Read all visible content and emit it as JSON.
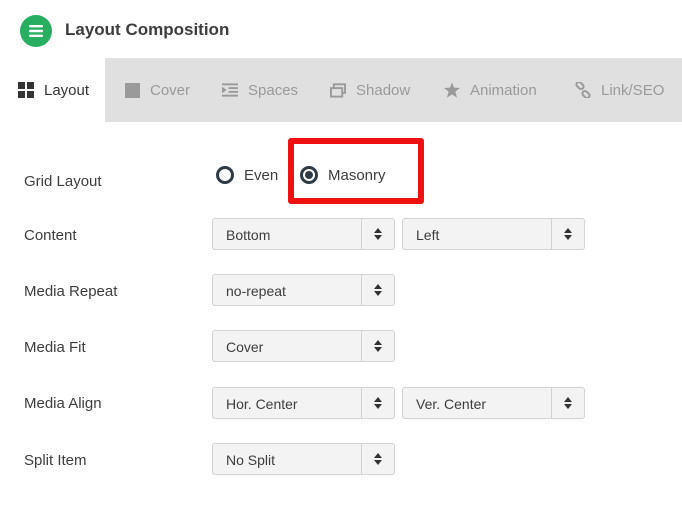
{
  "header": {
    "title": "Layout Composition",
    "icon": "list-icon",
    "accent": "#27ae60"
  },
  "tabs": [
    {
      "label": "Layout",
      "icon": "grid-icon",
      "active": true
    },
    {
      "label": "Cover",
      "icon": "square-icon",
      "active": false
    },
    {
      "label": "Spaces",
      "icon": "indent-icon",
      "active": false
    },
    {
      "label": "Shadow",
      "icon": "shadow-icon",
      "active": false
    },
    {
      "label": "Animation",
      "icon": "star-icon",
      "active": false
    },
    {
      "label": "Link/SEO",
      "icon": "link-icon",
      "active": false
    }
  ],
  "grid_layout": {
    "label": "Grid Layout",
    "options": [
      {
        "label": "Even",
        "checked": false
      },
      {
        "label": "Masonry",
        "checked": true
      }
    ],
    "highlight_color": "#ee1111"
  },
  "content": {
    "label": "Content",
    "vertical": "Bottom",
    "horizontal": "Left"
  },
  "media_repeat": {
    "label": "Media Repeat",
    "value": "no-repeat"
  },
  "media_fit": {
    "label": "Media Fit",
    "value": "Cover"
  },
  "media_align": {
    "label": "Media Align",
    "horizontal": "Hor. Center",
    "vertical": "Ver. Center"
  },
  "split_item": {
    "label": "Split Item",
    "value": "No Split"
  }
}
